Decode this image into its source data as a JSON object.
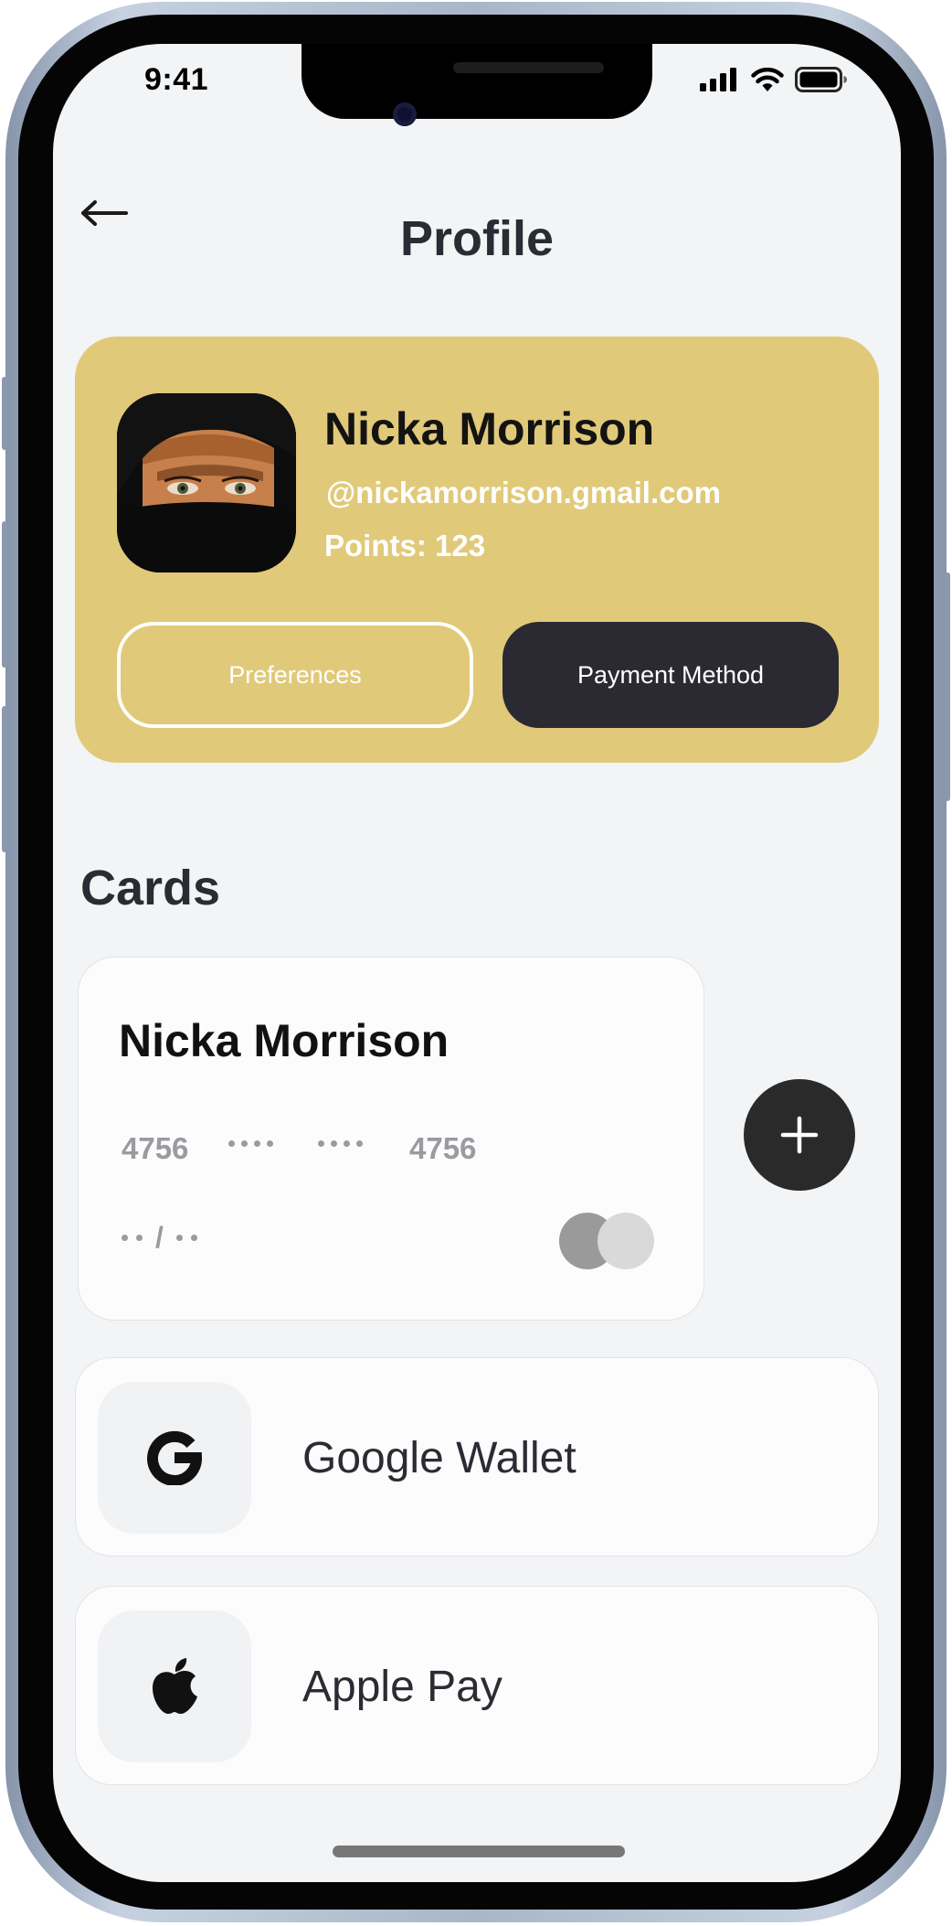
{
  "status_bar": {
    "time": "9:41"
  },
  "header": {
    "title": "Profile"
  },
  "profile": {
    "name": "Nicka Morrison",
    "email": "@nickamorrison.gmail.com",
    "points_label": "Points: 123",
    "preferences_label": "Preferences",
    "payment_method_label": "Payment Method"
  },
  "cards_section": {
    "heading": "Cards",
    "card": {
      "holder": "Nicka Morrison",
      "number_first": "4756",
      "number_last": "4756",
      "expiry_separator": "/"
    }
  },
  "payment_options": [
    {
      "label": "Google Wallet",
      "icon": "google-icon"
    },
    {
      "label": "Apple Pay",
      "icon": "apple-icon"
    }
  ],
  "colors": {
    "profile_card": "#e1c97a",
    "dark_button": "#2b2a33",
    "background": "#f3f4f6",
    "heading_text": "#2b2c33"
  }
}
